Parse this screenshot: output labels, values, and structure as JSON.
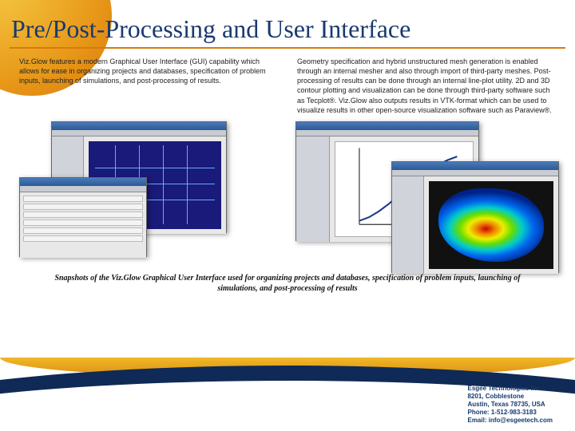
{
  "title": "Pre/Post-Processing and User Interface",
  "left_para": "Viz.Glow features a modern Graphical User Interface (GUI) capability which allows for ease in organizing projects and databases, specification of problem inputs, launching of simulations, and post-processing of results.",
  "right_para": "Geometry specification and hybrid unstructured mesh generation is enabled through an internal mesher and also through import of third-party meshes. Post-processing of results can be done through an internal line-plot utility. 2D and 3D contour plotting and visualization can be done through third-party software such as Tecplot®. Viz.Glow also outputs results in VTK-format which can be used to visualize results in other open-source visualization software such as Paraview®.",
  "caption": "Snapshots of the Viz.Glow Graphical User Interface used for organizing projects and databases, specification of problem inputs, launching of simulations, and post-processing of results",
  "footer": {
    "company": "Esgee Technologies Inc.",
    "addr1": "8201, Cobblestone",
    "addr2": "Austin, Texas 78735, USA",
    "phone_label": "Phone:",
    "phone": "1-512-983-3183",
    "email_label": "Email:",
    "email": "info@esgeetech.com"
  },
  "chart_data": {
    "type": "line",
    "title": "",
    "xlabel": "",
    "ylabel": "",
    "x": [
      0,
      1,
      2,
      3,
      4,
      5,
      6,
      7,
      8,
      9,
      10
    ],
    "values": [
      0.05,
      0.1,
      0.18,
      0.28,
      0.4,
      0.52,
      0.63,
      0.73,
      0.81,
      0.88,
      0.93
    ],
    "xlim": [
      0,
      10
    ],
    "ylim": [
      0,
      1
    ]
  }
}
